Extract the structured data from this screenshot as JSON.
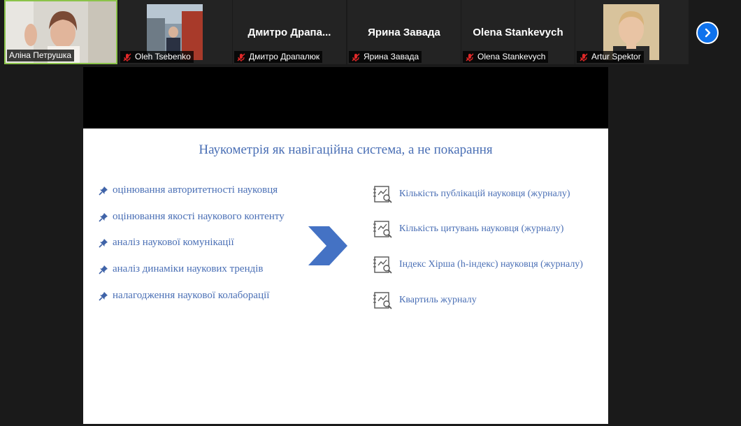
{
  "participants": [
    {
      "name": "Аліна Петрушка",
      "muted": false,
      "video": true,
      "active": true
    },
    {
      "name": "Oleh Tsebenko",
      "muted": true,
      "video": true,
      "active": false
    },
    {
      "name": "Дмитро Драпалюк",
      "display": "Дмитро  Драпа...",
      "muted": true,
      "video": false,
      "active": false
    },
    {
      "name": "Ярина Завада",
      "display": "Ярина Завада",
      "muted": true,
      "video": false,
      "active": false
    },
    {
      "name": "Olena Stankevych",
      "display": "Olena Stankevych",
      "muted": true,
      "video": false,
      "active": false
    },
    {
      "name": "Artur Spektor",
      "muted": true,
      "video": true,
      "active": false
    }
  ],
  "colors": {
    "accent": "#0e72ed",
    "active_border": "#8bc34a",
    "slide_text": "#4a6fb5",
    "muted_mic": "#e02828"
  },
  "slide": {
    "title": "Наукометрія як навігаційна система, а не покарання",
    "left_items": [
      "оцінювання авторитетності науковця",
      "оцінювання якості наукового контенту",
      "аналіз наукової комунікації",
      "аналіз динаміки наукових трендів",
      "налагодження наукової колаборації"
    ],
    "right_items": [
      "Кількість публікацій науковця (журналу)",
      "Кількість цитувань науковця (журналу)",
      "Індекс Хірша (h-індекс) науковця (журналу)",
      "Квартиль журналу"
    ]
  },
  "icons": {
    "next": "chevron-right-icon",
    "mic": "mic-off-icon",
    "bullet": "pushpin-icon",
    "doc": "document-chart-icon"
  }
}
